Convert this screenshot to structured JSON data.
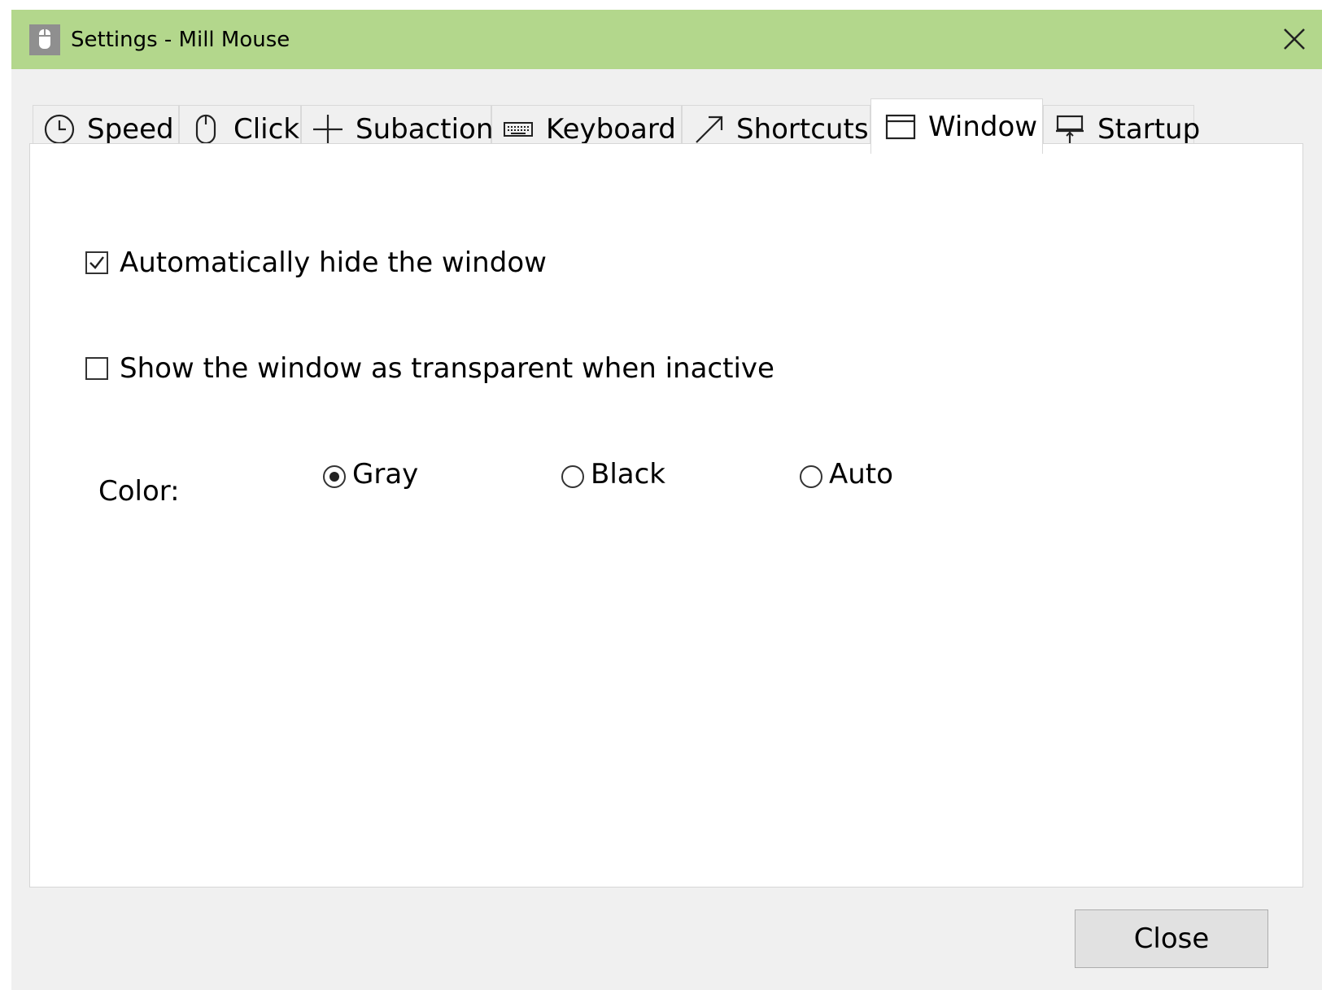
{
  "window": {
    "title": "Settings - Mill Mouse",
    "titlebar_color": "#b3d78c"
  },
  "tabs": [
    {
      "label": "Speed",
      "icon": "clock-icon",
      "active": false
    },
    {
      "label": "Click",
      "icon": "mouse-icon",
      "active": false
    },
    {
      "label": "Subaction",
      "icon": "plus-icon",
      "active": false
    },
    {
      "label": "Keyboard",
      "icon": "keyboard-icon",
      "active": false
    },
    {
      "label": "Shortcuts",
      "icon": "arrow-up-right-icon",
      "active": false
    },
    {
      "label": "Window",
      "icon": "window-icon",
      "active": true
    },
    {
      "label": "Startup",
      "icon": "pin-icon",
      "active": false
    }
  ],
  "panel": {
    "auto_hide": {
      "label": "Automatically hide the window",
      "checked": true
    },
    "transparent": {
      "label": "Show the window as transparent when inactive",
      "checked": false
    },
    "color": {
      "label": "Color:",
      "options": [
        {
          "label": "Gray",
          "selected": true
        },
        {
          "label": "Black",
          "selected": false
        },
        {
          "label": "Auto",
          "selected": false
        }
      ]
    }
  },
  "footer": {
    "close_label": "Close"
  }
}
